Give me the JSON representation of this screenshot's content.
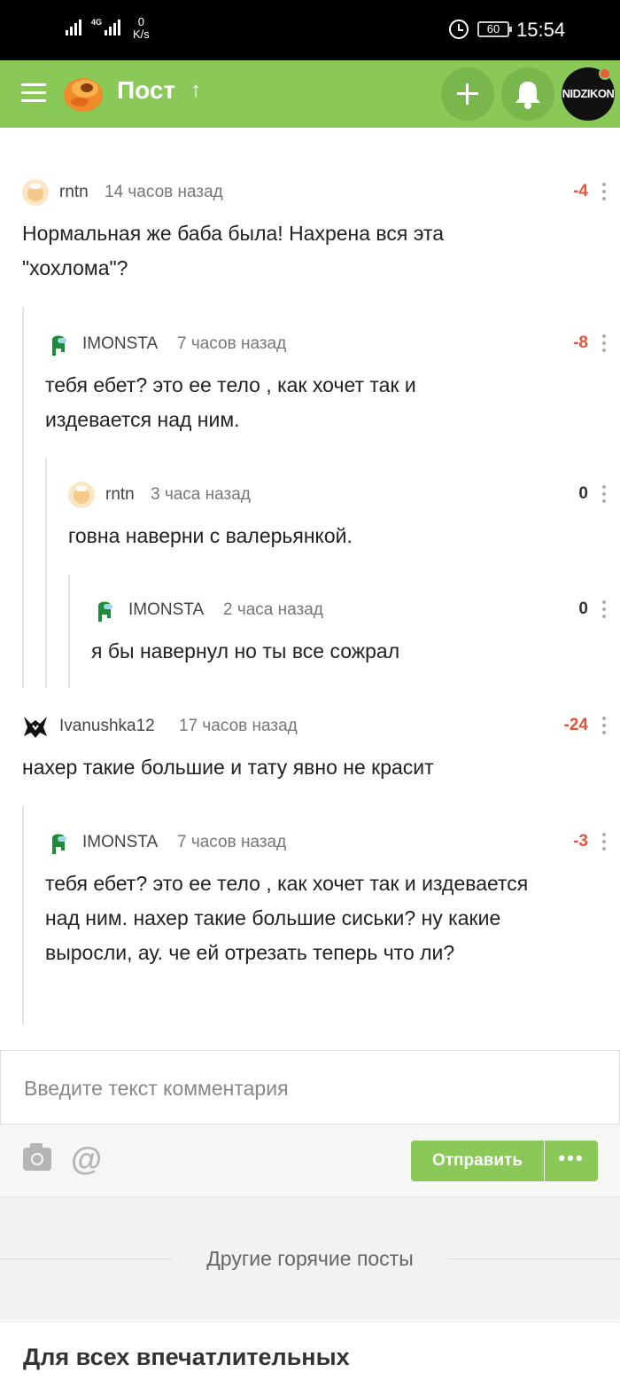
{
  "status_bar": {
    "net_speed": "0",
    "net_unit": "K/s",
    "network_type": "4G",
    "battery": "60",
    "time": "15:54"
  },
  "header": {
    "title": "Пост",
    "avatar_text": "NIDZIKON",
    "accent_color": "#8ac858"
  },
  "comments": [
    {
      "user": "rntn",
      "time": "14 часов назад",
      "rating": "-4",
      "text": "Нормальная же баба была! Нахрена вся эта \"хохлома\"?"
    },
    {
      "user": "IMONSTA",
      "time": "7 часов назад",
      "rating": "-8",
      "text": "тебя ебет? это ее тело , как хочет так и издевается над ним."
    },
    {
      "user": "rntn",
      "time": "3 часа назад",
      "rating": "0",
      "text": "говна наверни с валерьянкой."
    },
    {
      "user": "IMONSTA",
      "time": "2 часа назад",
      "rating": "0",
      "text": "я бы навернул но ты все сожрал"
    },
    {
      "user": "Ivanushka12",
      "time": "17 часов назад",
      "rating": "-24",
      "text": "нахер такие большие и тату явно не красит"
    },
    {
      "user": "IMONSTA",
      "time": "7 часов назад",
      "rating": "-3",
      "text": "тебя ебет? это ее тело , как хочет так и издевается над ним. нахер такие большие сиськи? ну какие выросли, ау. че ей отрезать теперь что ли?"
    }
  ],
  "comment_input": {
    "placeholder": "Введите текст комментария",
    "value": ""
  },
  "send_button": "Отправить",
  "more_dots": "•••",
  "at_symbol": "@",
  "hot_posts_title": "Другие горячие посты",
  "post_card_title": "Для всех впечатлительных"
}
